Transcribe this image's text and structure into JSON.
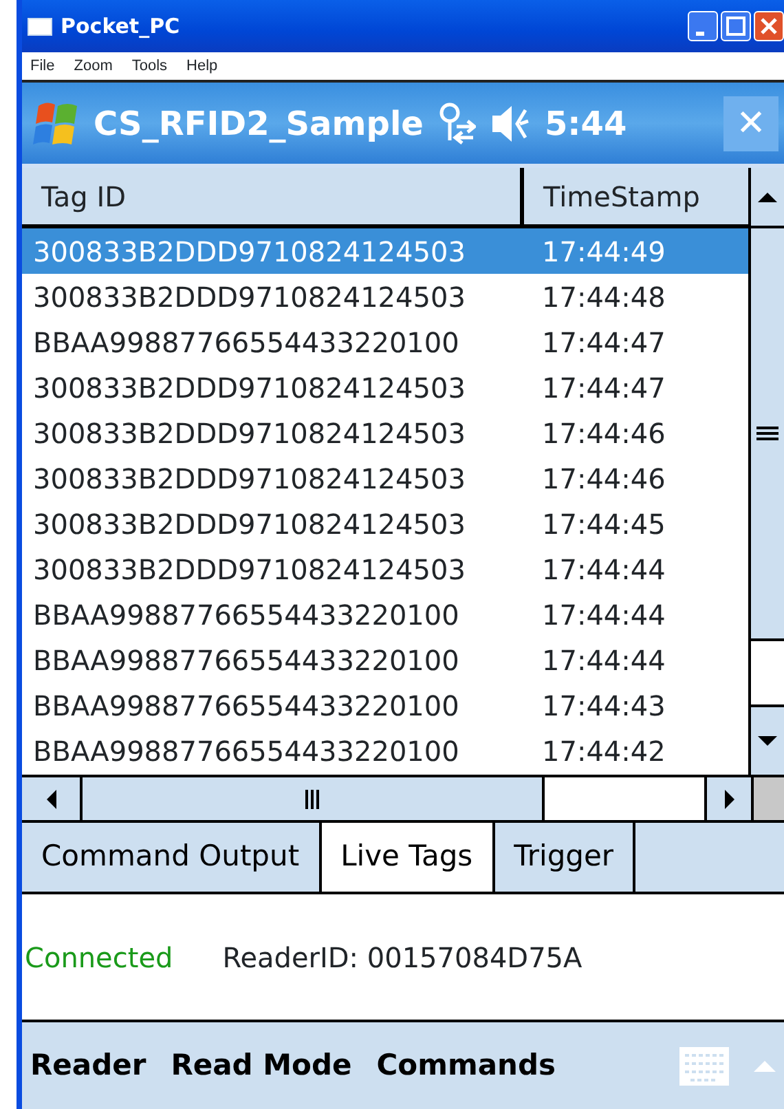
{
  "window": {
    "title": "Pocket_PC"
  },
  "menu": [
    "File",
    "Zoom",
    "Tools",
    "Help"
  ],
  "app_bar": {
    "title": "CS_RFID2_Sample",
    "time": "5:44",
    "close": "✕"
  },
  "table": {
    "columns": [
      "Tag ID",
      "TimeStamp"
    ],
    "rows": [
      {
        "tag_id": "300833B2DDD9710824124503",
        "timestamp": "17:44:49",
        "selected": true
      },
      {
        "tag_id": "300833B2DDD9710824124503",
        "timestamp": "17:44:48",
        "selected": false
      },
      {
        "tag_id": "BBAA99887766554433220100",
        "timestamp": "17:44:47",
        "selected": false
      },
      {
        "tag_id": "300833B2DDD9710824124503",
        "timestamp": "17:44:47",
        "selected": false
      },
      {
        "tag_id": "300833B2DDD9710824124503",
        "timestamp": "17:44:46",
        "selected": false
      },
      {
        "tag_id": "300833B2DDD9710824124503",
        "timestamp": "17:44:46",
        "selected": false
      },
      {
        "tag_id": "300833B2DDD9710824124503",
        "timestamp": "17:44:45",
        "selected": false
      },
      {
        "tag_id": "300833B2DDD9710824124503",
        "timestamp": "17:44:44",
        "selected": false
      },
      {
        "tag_id": "BBAA99887766554433220100",
        "timestamp": "17:44:44",
        "selected": false
      },
      {
        "tag_id": "BBAA99887766554433220100",
        "timestamp": "17:44:44",
        "selected": false
      },
      {
        "tag_id": "BBAA99887766554433220100",
        "timestamp": "17:44:43",
        "selected": false
      },
      {
        "tag_id": "BBAA99887766554433220100",
        "timestamp": "17:44:42",
        "selected": false
      }
    ]
  },
  "tabs": [
    {
      "label": "Command Output",
      "selected": false
    },
    {
      "label": "Live Tags",
      "selected": true
    },
    {
      "label": "Trigger",
      "selected": false
    }
  ],
  "status": {
    "connection": "Connected",
    "reader_id": "ReaderID: 00157084D75A"
  },
  "soft_keys": [
    "Reader",
    "Read Mode",
    "Commands"
  ]
}
